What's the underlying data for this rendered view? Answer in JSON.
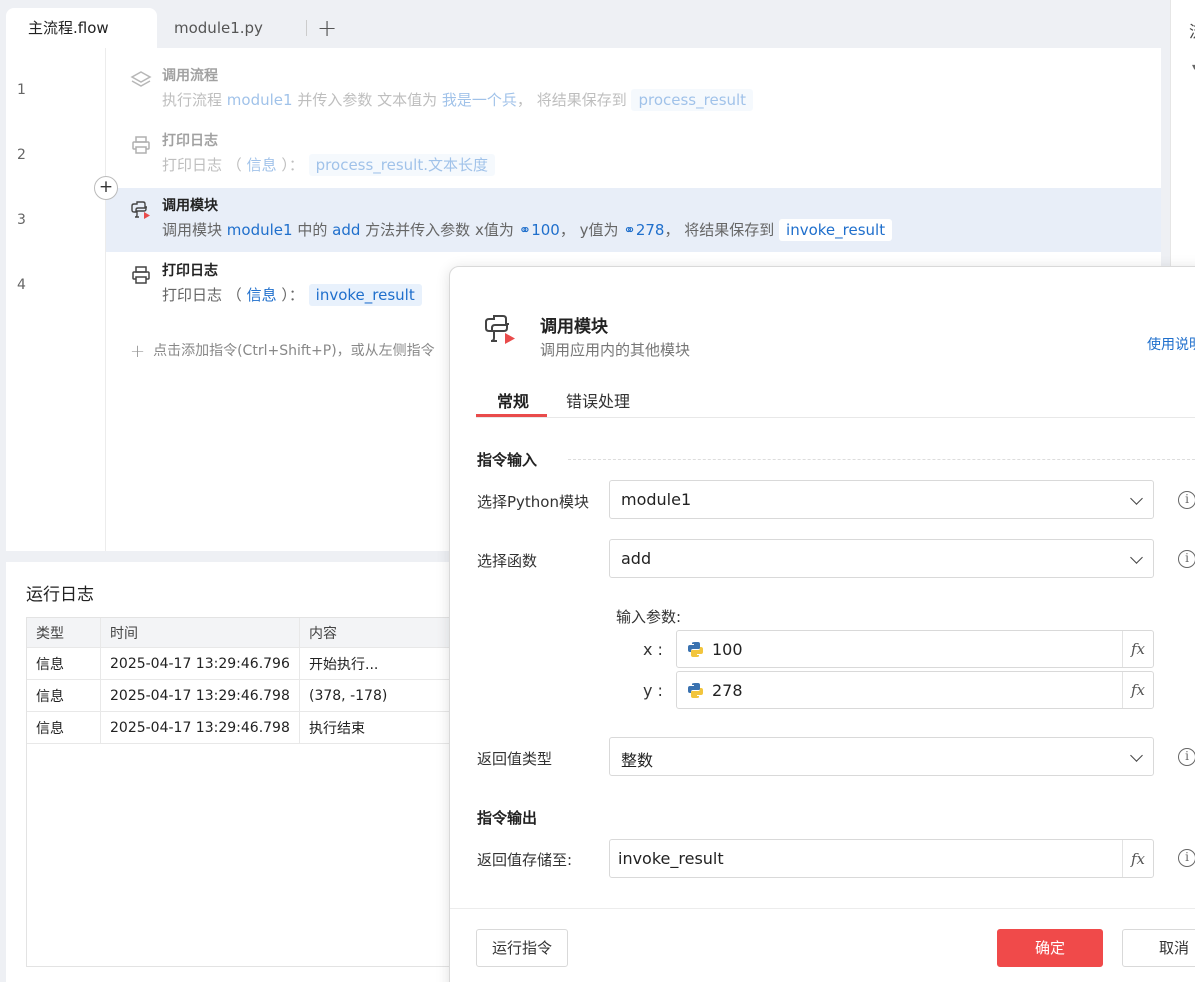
{
  "tabs": [
    {
      "label": "主流程.flow",
      "active": true
    },
    {
      "label": "module1.py",
      "active": false
    }
  ],
  "right_panel": {
    "title": "流"
  },
  "editor": {
    "line_numbers": [
      "1",
      "2",
      "3",
      "4"
    ],
    "rows": [
      {
        "title": "调用流程",
        "desc": {
          "p1": "执行流程",
          "module": "module1",
          "p2": "并传入参数 文本值为",
          "val": "我是一个兵",
          "p3": "， 将结果保存到",
          "chip": "process_result"
        }
      },
      {
        "title": "打印日志",
        "desc": {
          "p1": "打印日志 （",
          "level": "信息",
          "p2": "）：",
          "chip": "process_result.文本长度"
        }
      },
      {
        "title": "调用模块",
        "desc": {
          "p1": "调用模块",
          "module": "module1",
          "p2": "中的",
          "func": "add",
          "p3": "方法并传入参数 x值为",
          "x": "100",
          "p4": "， y值为",
          "y": "278",
          "p5": "， 将结果保存到",
          "chip": "invoke_result"
        }
      },
      {
        "title": "打印日志",
        "desc": {
          "p1": "打印日志 （",
          "level": "信息",
          "p2": "）：",
          "chip": "invoke_result"
        }
      }
    ],
    "add_hint": "点击添加指令(Ctrl+Shift+P)，或从左侧指令"
  },
  "log": {
    "title": "运行日志",
    "columns": [
      "类型",
      "时间",
      "内容"
    ],
    "rows": [
      [
        "信息",
        "2025-04-17 13:29:46.796",
        "开始执行..."
      ],
      [
        "信息",
        "2025-04-17 13:29:46.798",
        "(378, -178)"
      ],
      [
        "信息",
        "2025-04-17 13:29:46.798",
        "执行结束"
      ]
    ]
  },
  "dialog": {
    "title": "调用模块",
    "subtitle": "调用应用内的其他模块",
    "help_link": "使用说明",
    "tabs": [
      "常规",
      "错误处理"
    ],
    "section_input": "指令输入",
    "module_label": "选择Python模块",
    "module_value": "module1",
    "func_label": "选择函数",
    "func_value": "add",
    "params_title": "输入参数:",
    "params": [
      {
        "name": "x :",
        "value": "100"
      },
      {
        "name": "y :",
        "value": "278"
      }
    ],
    "return_type_label": "返回值类型",
    "return_type_value": "整数",
    "section_output": "指令输出",
    "save_label": "返回值存储至:",
    "save_value": "invoke_result",
    "fx": "fx",
    "info": "i",
    "run_button": "运行指令",
    "ok_button": "确定",
    "cancel_button": "取消"
  },
  "colors": {
    "accent": "#f04a4a",
    "link": "#1f6fcc",
    "selected_row": "#e8eef8"
  }
}
